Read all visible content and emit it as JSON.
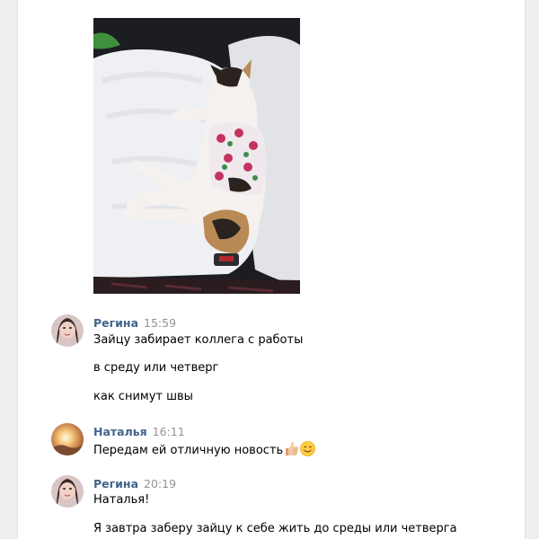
{
  "photo": {
    "alt_name": "cat-photo",
    "colors": {
      "car_dark": "#1c1d22",
      "seat_blanket": "#eef0f3",
      "cat_fur": "#f4f1ee",
      "patch_dark": "#2a2320",
      "patch_orange": "#b98a56",
      "outfit": "#efe9ee",
      "flower_red": "#c3345d",
      "flower_green": "#3c8c4a"
    }
  },
  "messages": [
    {
      "author": "Регина",
      "time": "15:59",
      "avatar_icon": "user-avatar-photo",
      "lines": [
        "Зайцу забирает коллега с работы",
        "в среду или четверг",
        "как снимут швы"
      ]
    },
    {
      "author": "Наталья",
      "time": "16:11",
      "avatar_icon": "user-avatar-photo",
      "lines": [
        "Передам ей отличную новость"
      ],
      "emojis": [
        "thumbs-up-emoji",
        "smile-emoji"
      ]
    },
    {
      "author": "Регина",
      "time": "20:19",
      "avatar_icon": "user-avatar-photo",
      "lines": [
        "Наталья!",
        "Я завтра заберу зайцу к себе жить до среды или четверга"
      ]
    }
  ],
  "colors": {
    "background": "#edeef0",
    "panel": "#ffffff",
    "author_link": "#42648b",
    "timestamp": "#939393",
    "text": "#000000"
  }
}
